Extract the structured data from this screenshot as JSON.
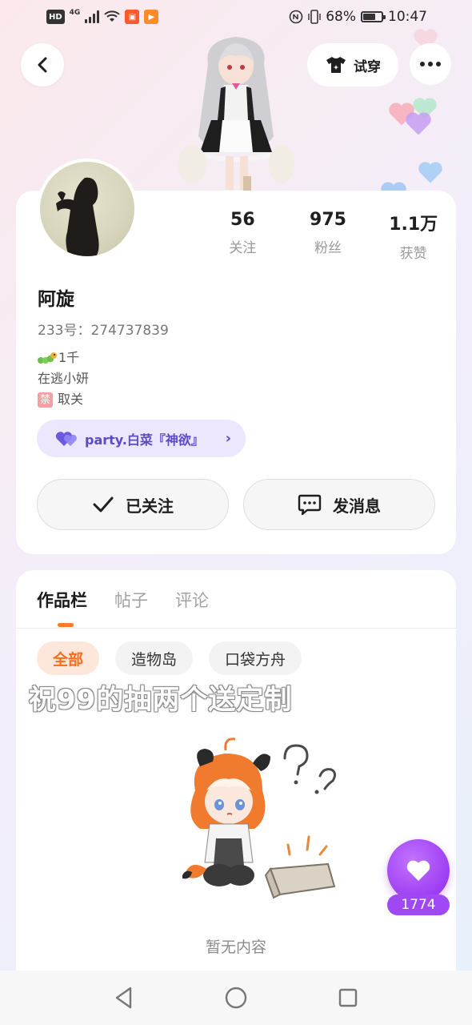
{
  "status_bar": {
    "hd": "HD",
    "network": "4G",
    "battery_percent": "68%",
    "battery_level": 0.68,
    "time": "10:47"
  },
  "header": {
    "tryon_label": "试穿"
  },
  "profile": {
    "following_count": "56",
    "following_label": "关注",
    "followers_count": "975",
    "followers_label": "粉丝",
    "likes_count": "1.1万",
    "likes_label": "获赞",
    "username": "阿旋",
    "uid_text": "233号：274737839",
    "bio": {
      "level_text": "1千",
      "line2": "在逃小妍",
      "ban_char": "禁",
      "line3": "取关"
    },
    "party_label": "party.白菜『神欲』",
    "follow_button": "已关注",
    "message_button": "发消息"
  },
  "works": {
    "tabs": [
      "作品栏",
      "帖子",
      "评论"
    ],
    "active_tab": 0,
    "chips": [
      "全部",
      "造物岛",
      "口袋方舟"
    ],
    "active_chip": 0,
    "empty_text": "暂无内容"
  },
  "overlay_caption": "祝99的抽两个送定制",
  "like": {
    "count": "1774"
  },
  "colors": {
    "accent_orange": "#ff7a28",
    "party_purple": "#5b4bc8",
    "like_purple": "#9d3df3"
  },
  "icons": {
    "back": "chevron-left-icon",
    "tryon": "tshirt-icon",
    "more": "more-dots-icon",
    "follow": "check-icon",
    "message": "chat-bubble-icon",
    "party": "heart-icon",
    "like": "heart-icon"
  }
}
